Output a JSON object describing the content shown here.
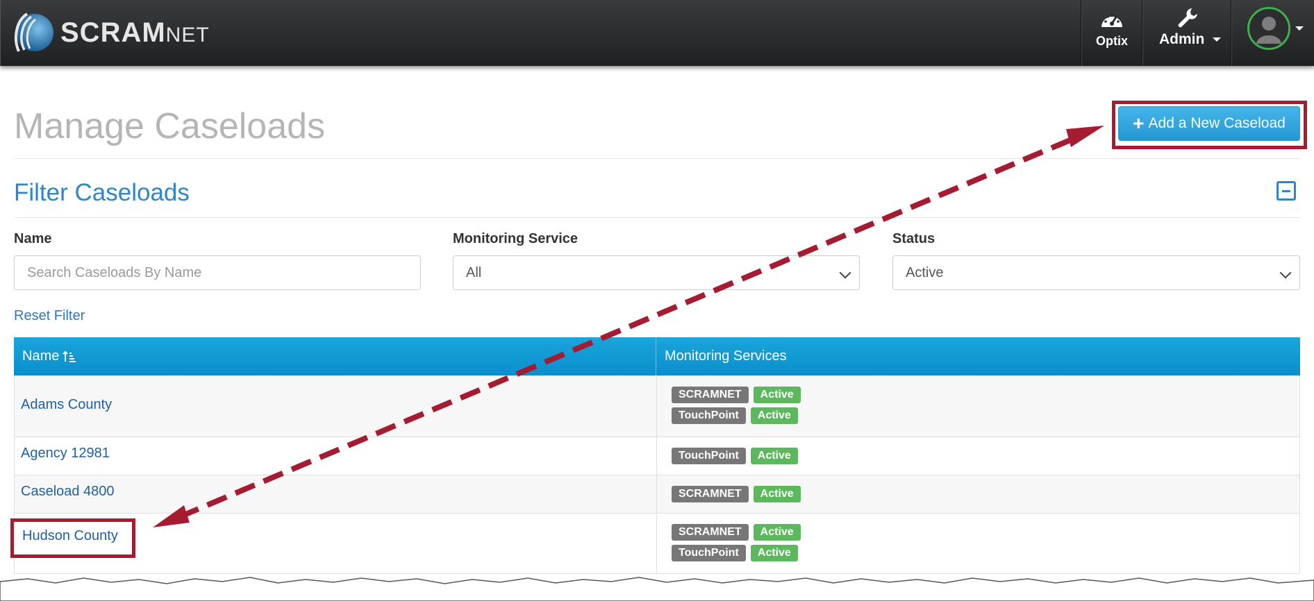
{
  "brand": {
    "logo_text_big": "SCRAM",
    "logo_text_small": "NET"
  },
  "nav": {
    "optix": {
      "label": "Optix",
      "icon": "dashboard-gauge-icon"
    },
    "admin": {
      "label": "Admin",
      "icon": "wrench-icon"
    },
    "user": {
      "icon": "user-avatar-icon"
    }
  },
  "page": {
    "title": "Manage Caseloads",
    "add_button": "Add a New Caseload"
  },
  "filter": {
    "title": "Filter Caseloads",
    "name_label": "Name",
    "name_placeholder": "Search Caseloads By Name",
    "service_label": "Monitoring Service",
    "service_value": "All",
    "status_label": "Status",
    "status_value": "Active",
    "reset_label": "Reset Filter"
  },
  "table": {
    "columns": [
      "Name",
      "Monitoring Services"
    ],
    "sort_icon": "sort-ascending-icon",
    "rows": [
      {
        "name": "Adams County",
        "services": [
          {
            "service": "SCRAMNET",
            "status": "Active"
          },
          {
            "service": "TouchPoint",
            "status": "Active"
          }
        ]
      },
      {
        "name": "Agency 12981",
        "services": [
          {
            "service": "TouchPoint",
            "status": "Active"
          }
        ]
      },
      {
        "name": "Caseload 4800",
        "services": [
          {
            "service": "SCRAMNET",
            "status": "Active"
          }
        ]
      },
      {
        "name": "Hudson County",
        "services": [
          {
            "service": "SCRAMNET",
            "status": "Active"
          },
          {
            "service": "TouchPoint",
            "status": "Active"
          }
        ]
      }
    ]
  },
  "colors": {
    "accent_blue": "#2f86c4",
    "table_header": "#0a8fcc",
    "active_badge": "#5cb85c",
    "service_badge": "#777777",
    "annotation_red": "#a51c30"
  }
}
